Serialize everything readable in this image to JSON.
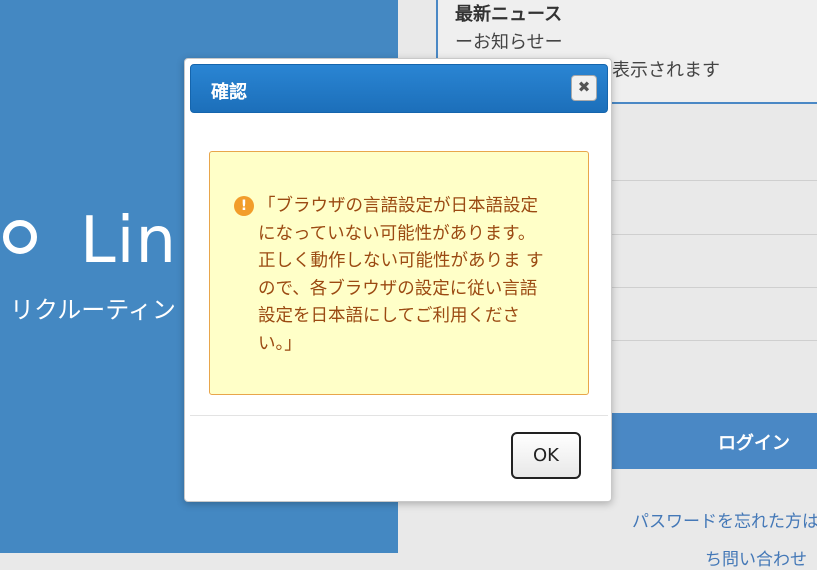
{
  "background": {
    "brand": {
      "name": "Lin",
      "tagline": "リクルーティン"
    },
    "news": {
      "title": "最新ニュース",
      "subtitle": "ーお知らせー",
      "body": "表示されます"
    },
    "login": {
      "button_label": "ログイン",
      "forgot_link": "パスワードを忘れた方は",
      "extra_link": "ち問い合わせ"
    }
  },
  "dialog": {
    "title": "確認",
    "close_icon": "close-icon",
    "warning_icon": "exclamation-icon",
    "message_lines": [
      "「ブラウザの言語設定が日本語設定",
      "になっていない可能性があります。",
      "正しく動作しない可能性がありま す",
      "ので、各ブラウザの設定に従い言語",
      "設定を日本語にしてご利用くださ",
      "い。」"
    ],
    "ok_label": "OK"
  },
  "colors": {
    "left_panel": "#4488c2",
    "header": "#1c6fba",
    "warning_bg": "#ffffc8",
    "warning_border": "#e8a64b",
    "warning_text": "#9b4a12"
  }
}
